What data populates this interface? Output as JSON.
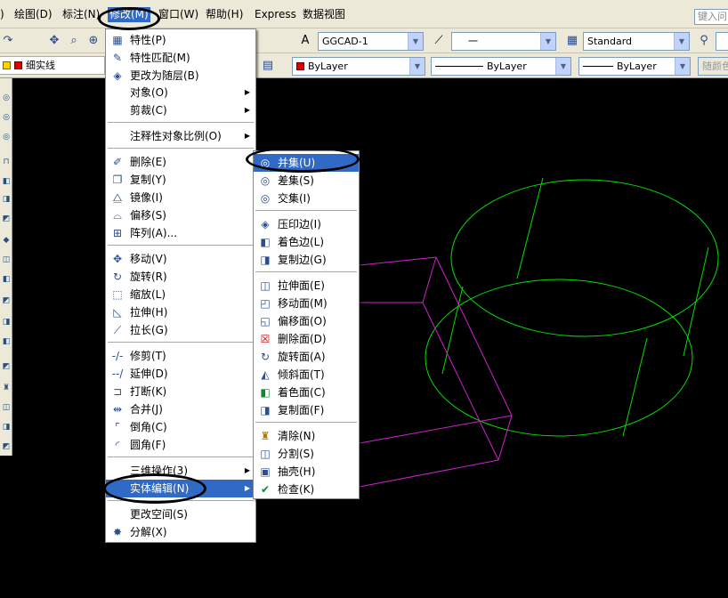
{
  "menubar": {
    "items": [
      {
        "label": ")"
      },
      {
        "label": "绘图(D)"
      },
      {
        "label": "标注(N)"
      },
      {
        "label": "修改(M)"
      },
      {
        "label": "窗口(W)"
      },
      {
        "label": "帮助(H)"
      },
      {
        "label": "Express"
      },
      {
        "label": "数据视图"
      }
    ],
    "search_placeholder": "键入问"
  },
  "toolbar1": {
    "text_style": "GGCAD-1",
    "dim_style": "一",
    "table_style": "Standard"
  },
  "toolbar2": {
    "layer": "细实线",
    "color": "ByLayer",
    "linetype": "ByLayer",
    "lineweight": "ByLayer",
    "plot_style": "随颜色"
  },
  "modify_menu": {
    "items": [
      {
        "label": "特性(P)",
        "icon": "properties-icon"
      },
      {
        "label": "特性匹配(M)",
        "icon": "match-properties-icon"
      },
      {
        "label": "更改为随层(B)",
        "icon": "change-bylayer-icon"
      },
      {
        "label": "对象(O)",
        "submenu": true
      },
      {
        "label": "剪裁(C)",
        "submenu": true
      },
      {
        "label": "注释性对象比例(O)",
        "submenu": true
      },
      {
        "label": "删除(E)",
        "icon": "erase-icon"
      },
      {
        "label": "复制(Y)",
        "icon": "copy-icon"
      },
      {
        "label": "镜像(I)",
        "icon": "mirror-icon"
      },
      {
        "label": "偏移(S)",
        "icon": "offset-icon"
      },
      {
        "label": "阵列(A)...",
        "icon": "array-icon"
      },
      {
        "label": "移动(V)",
        "icon": "move-icon"
      },
      {
        "label": "旋转(R)",
        "icon": "rotate-icon"
      },
      {
        "label": "缩放(L)",
        "icon": "scale-icon"
      },
      {
        "label": "拉伸(H)",
        "icon": "stretch-icon"
      },
      {
        "label": "拉长(G)",
        "icon": "lengthen-icon"
      },
      {
        "label": "修剪(T)",
        "icon": "trim-icon"
      },
      {
        "label": "延伸(D)",
        "icon": "extend-icon"
      },
      {
        "label": "打断(K)",
        "icon": "break-icon"
      },
      {
        "label": "合并(J)",
        "icon": "join-icon"
      },
      {
        "label": "倒角(C)",
        "icon": "chamfer-icon"
      },
      {
        "label": "圆角(F)",
        "icon": "fillet-icon"
      },
      {
        "label": "三维操作(3)",
        "submenu": true
      },
      {
        "label": "实体编辑(N)",
        "submenu": true,
        "selected": true
      },
      {
        "label": "更改空间(S)"
      },
      {
        "label": "分解(X)",
        "icon": "explode-icon"
      }
    ]
  },
  "solid_edit_menu": {
    "items": [
      {
        "label": "并集(U)",
        "icon": "union-icon",
        "selected": true
      },
      {
        "label": "差集(S)",
        "icon": "subtract-icon"
      },
      {
        "label": "交集(I)",
        "icon": "intersect-icon"
      },
      {
        "label": "压印边(I)",
        "icon": "imprint-edges-icon"
      },
      {
        "label": "着色边(L)",
        "icon": "color-edges-icon"
      },
      {
        "label": "复制边(G)",
        "icon": "copy-edges-icon"
      },
      {
        "label": "拉伸面(E)",
        "icon": "extrude-faces-icon"
      },
      {
        "label": "移动面(M)",
        "icon": "move-faces-icon"
      },
      {
        "label": "偏移面(O)",
        "icon": "offset-faces-icon"
      },
      {
        "label": "删除面(D)",
        "icon": "delete-faces-icon"
      },
      {
        "label": "旋转面(A)",
        "icon": "rotate-faces-icon"
      },
      {
        "label": "倾斜面(T)",
        "icon": "taper-faces-icon"
      },
      {
        "label": "着色面(C)",
        "icon": "color-faces-icon"
      },
      {
        "label": "复制面(F)",
        "icon": "copy-faces-icon"
      },
      {
        "label": "清除(N)",
        "icon": "clean-icon"
      },
      {
        "label": "分割(S)",
        "icon": "separate-icon"
      },
      {
        "label": "抽壳(H)",
        "icon": "shell-icon"
      },
      {
        "label": "检查(K)",
        "icon": "check-icon"
      }
    ]
  },
  "colors": {
    "selection": "#316ac5",
    "canvas": "#000000",
    "cylinder": "#00e000",
    "box": "#d020d0"
  }
}
